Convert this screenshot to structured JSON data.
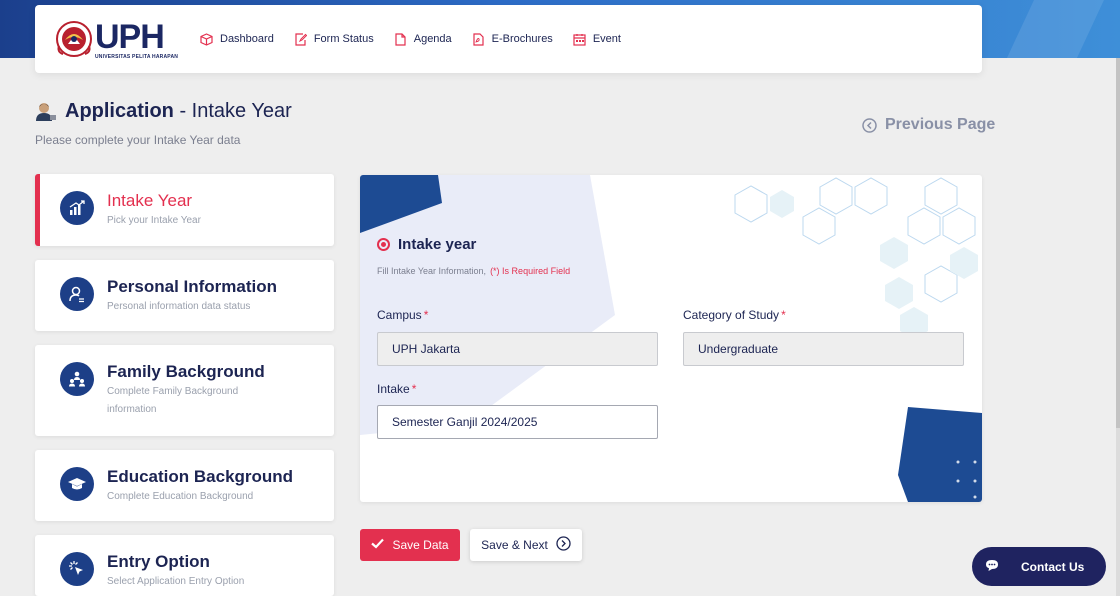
{
  "logo": {
    "text": "UPH",
    "subtitle": "UNIVERSITAS PELITA HARAPAN"
  },
  "nav": [
    {
      "label": "Dashboard",
      "icon": "box-icon"
    },
    {
      "label": "Form Status",
      "icon": "form-edit-icon"
    },
    {
      "label": "Agenda",
      "icon": "document-icon"
    },
    {
      "label": "E-Brochures",
      "icon": "pdf-icon"
    },
    {
      "label": "Event",
      "icon": "calendar-icon"
    }
  ],
  "page": {
    "title_bold": "Application",
    "title_rest": " - Intake Year",
    "subtitle": "Please complete your Intake Year data",
    "previous_page": "Previous Page"
  },
  "steps": [
    {
      "title": "Intake Year",
      "desc": "Pick your Intake Year",
      "icon": "chart-icon",
      "active": true
    },
    {
      "title": "Personal Information",
      "desc": "Personal information data status",
      "icon": "person-search-icon",
      "active": false
    },
    {
      "title": "Family Background",
      "desc": "Complete Family Background information",
      "icon": "family-icon",
      "active": false
    },
    {
      "title": "Education Background",
      "desc": "Complete Education Background",
      "icon": "graduation-cap-icon",
      "active": false
    },
    {
      "title": "Entry Option",
      "desc": "Select Application Entry Option",
      "icon": "cursor-click-icon",
      "active": false
    }
  ],
  "form": {
    "title": "Intake year",
    "note": "Fill Intake Year Information,",
    "required_note": "(*) Is Required Field",
    "campus_label": "Campus",
    "campus_value": "UPH Jakarta",
    "category_label": "Category of Study",
    "category_value": "Undergraduate",
    "intake_label": "Intake",
    "intake_value": "Semester Ganjil 2024/2025",
    "required_mark": "*"
  },
  "buttons": {
    "save": "Save Data",
    "save_next": "Save & Next",
    "contact": "Contact Us"
  },
  "colors": {
    "accent": "#e3304f",
    "navy": "#1c2452",
    "icon_bg": "#1d3f87"
  }
}
